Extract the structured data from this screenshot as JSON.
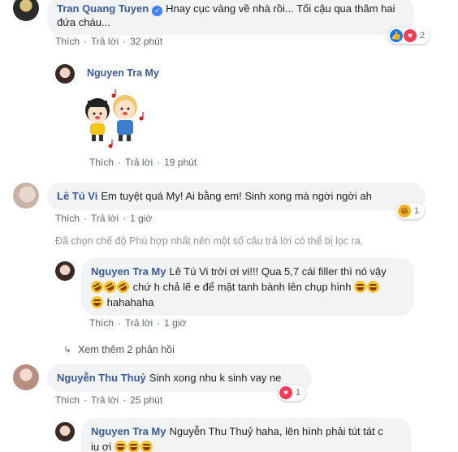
{
  "c1": {
    "name": "Tran Quang Tuyen",
    "text": "Hnay cục vàng về nhà rồi... Tối cậu qua thăm hai đứa cháu...",
    "like": "Thích",
    "reply": "Trả lời",
    "time": "32 phút",
    "reactions": "2"
  },
  "c2": {
    "name": "Nguyen Tra My",
    "like": "Thích",
    "reply": "Trả lời",
    "time": "19 phút"
  },
  "c3": {
    "name": "Lê Tú Vi",
    "text": "Em tuyệt quá My! Ai bằng em! Sinh xong mà ngời ngời ah",
    "like": "Thích",
    "reply": "Trả lời",
    "time": "1 giờ",
    "reactions": "1"
  },
  "notice": "Đã chọn chế độ Phù hợp nhất nên một số câu trả lời có thể bị lọc ra.",
  "c4": {
    "name": "Nguyen Tra My",
    "line1": "Lê Tú Vi trời ơi vi!!! Qua 5,7 cái filler thì nó vậy",
    "line2": "chứ h chả lẽ e để mặt tanh bành lên chụp hình",
    "line3": "hahahaha",
    "like": "Thích",
    "reply": "Trả lời",
    "time": "1 giờ"
  },
  "more": "Xem thêm 2 phản hồi",
  "c5": {
    "name": "Nguyễn Thu Thuỷ",
    "text": "Sinh xong nhu k sinh vay ne",
    "like": "Thích",
    "reply": "Trả lời",
    "time": "25 phút",
    "reactions": "1"
  },
  "c6": {
    "name": "Nguyen Tra My",
    "line1": "Nguyễn Thu Thuỷ haha, lên hình phải tút tát c",
    "line2": "iu ơi"
  },
  "icons": [
    "verified-icon",
    "like-reaction-icon",
    "love-reaction-icon",
    "haha-reaction-icon",
    "rofl-emoji",
    "laughing-emoji",
    "reply-arrow-icon",
    "music-note-icon"
  ],
  "colors": {
    "name": "#385898",
    "bubble": "#f2f3f5",
    "meta": "#606770",
    "like": "#1877f2",
    "love": "#f33e58",
    "haha": "#f7b125"
  }
}
